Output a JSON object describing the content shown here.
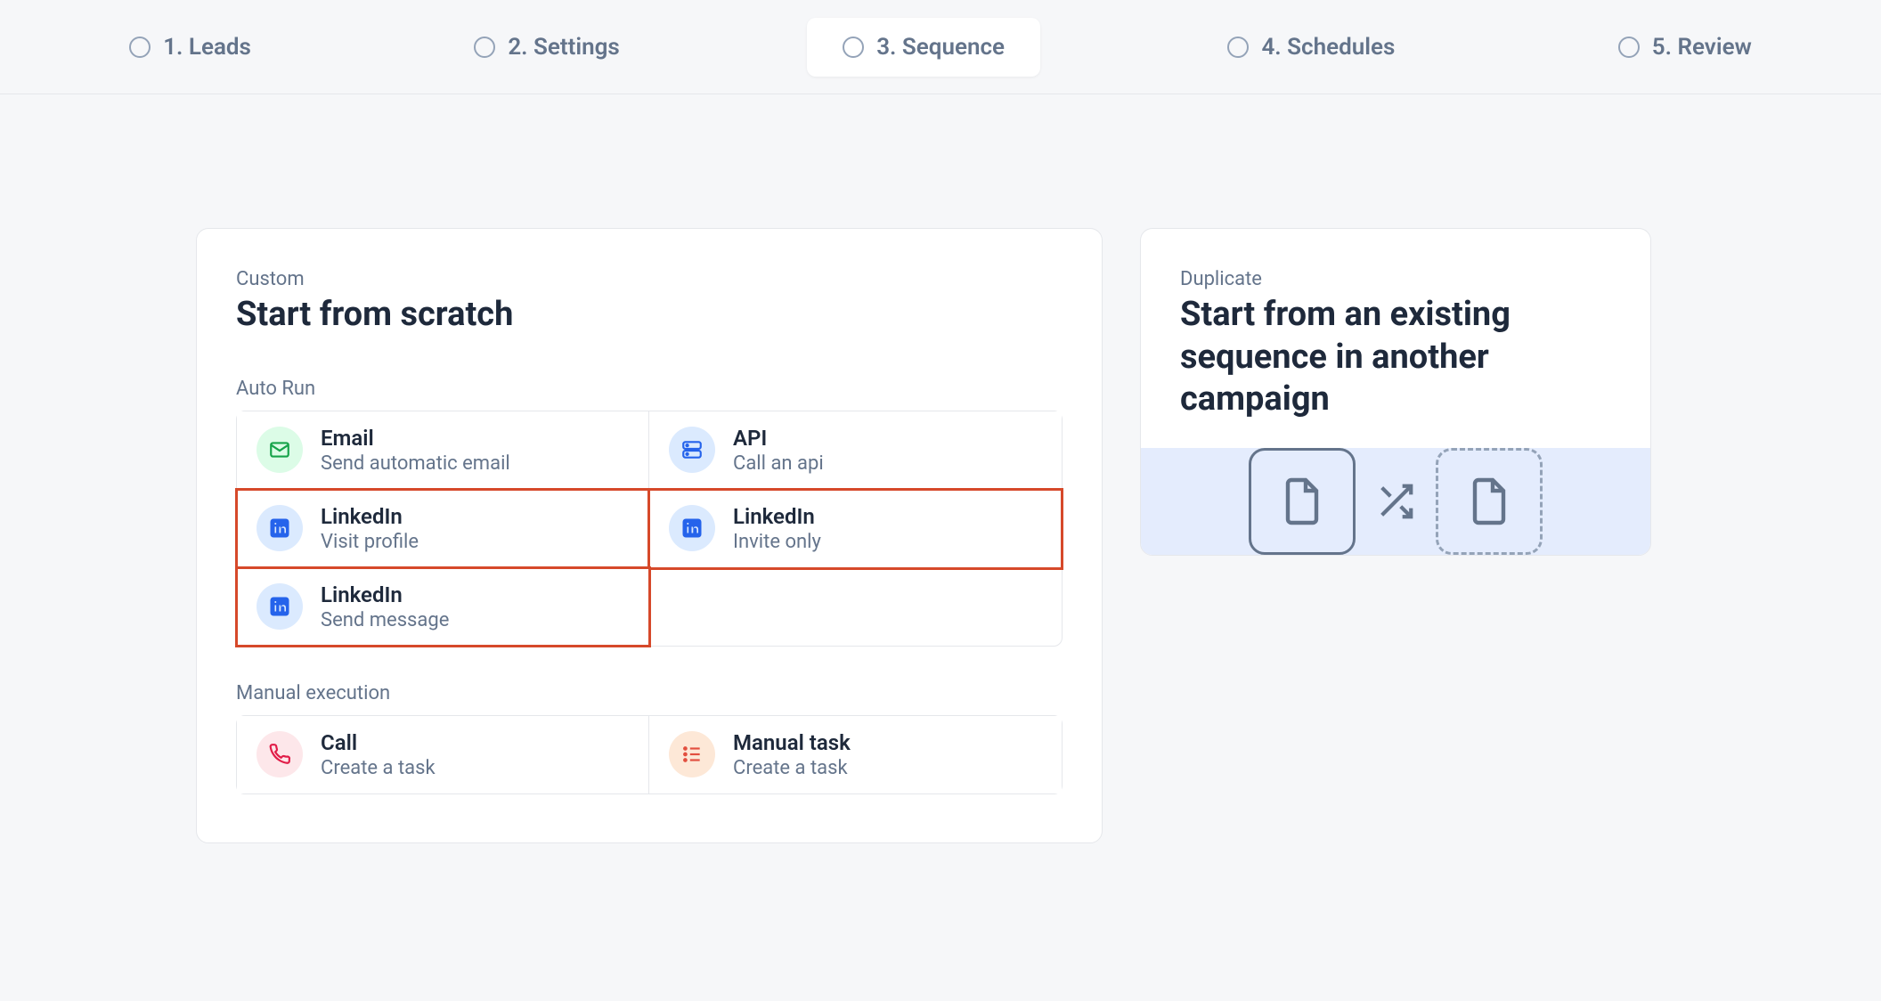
{
  "steps": [
    {
      "label": "1. Leads"
    },
    {
      "label": "2. Settings"
    },
    {
      "label": "3. Sequence",
      "active": true
    },
    {
      "label": "4. Schedules"
    },
    {
      "label": "5. Review"
    }
  ],
  "custom": {
    "eyebrow": "Custom",
    "title": "Start from scratch",
    "auto_label": "Auto Run",
    "manual_label": "Manual execution",
    "auto_options": [
      {
        "title": "Email",
        "sub": "Send automatic email",
        "icon": "mail-icon",
        "tone": "green",
        "highlight": false
      },
      {
        "title": "API",
        "sub": "Call an api",
        "icon": "server-icon",
        "tone": "blue",
        "highlight": false
      },
      {
        "title": "LinkedIn",
        "sub": "Visit profile",
        "icon": "linkedin-icon",
        "tone": "blue",
        "highlight": true
      },
      {
        "title": "LinkedIn",
        "sub": "Invite only",
        "icon": "linkedin-icon",
        "tone": "blue",
        "highlight": true
      },
      {
        "title": "LinkedIn",
        "sub": "Send message",
        "icon": "linkedin-icon",
        "tone": "blue",
        "highlight": true
      }
    ],
    "manual_options": [
      {
        "title": "Call",
        "sub": "Create a task",
        "icon": "phone-icon",
        "tone": "pink"
      },
      {
        "title": "Manual task",
        "sub": "Create a task",
        "icon": "list-icon",
        "tone": "peach"
      }
    ]
  },
  "duplicate": {
    "eyebrow": "Duplicate",
    "title": "Start from an existing sequence in another campaign"
  }
}
